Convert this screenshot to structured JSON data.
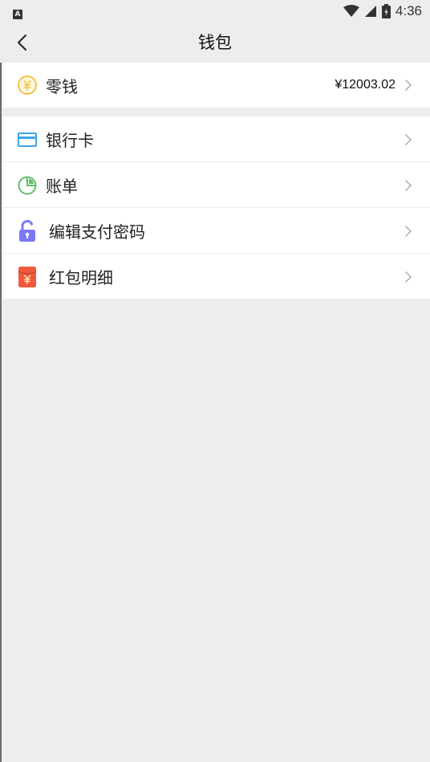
{
  "status_bar": {
    "time": "4:36",
    "notification_glyph": "A"
  },
  "header": {
    "title": "钱包"
  },
  "wallet": {
    "label": "零钱",
    "balance": "¥12003.02"
  },
  "menu": {
    "items": [
      {
        "label": "银行卡",
        "icon": "bank-card-icon"
      },
      {
        "label": "账单",
        "icon": "pie-chart-icon"
      },
      {
        "label": "编辑支付密码",
        "icon": "padlock-icon"
      },
      {
        "label": "红包明细",
        "icon": "red-packet-icon"
      }
    ]
  },
  "colors": {
    "background": "#ededed",
    "coin": "#f0c24c",
    "card": "#3ea4e8",
    "bill": "#5dbf6a",
    "lock": "#7b78f5",
    "red_packet": "#ef5a3e"
  }
}
